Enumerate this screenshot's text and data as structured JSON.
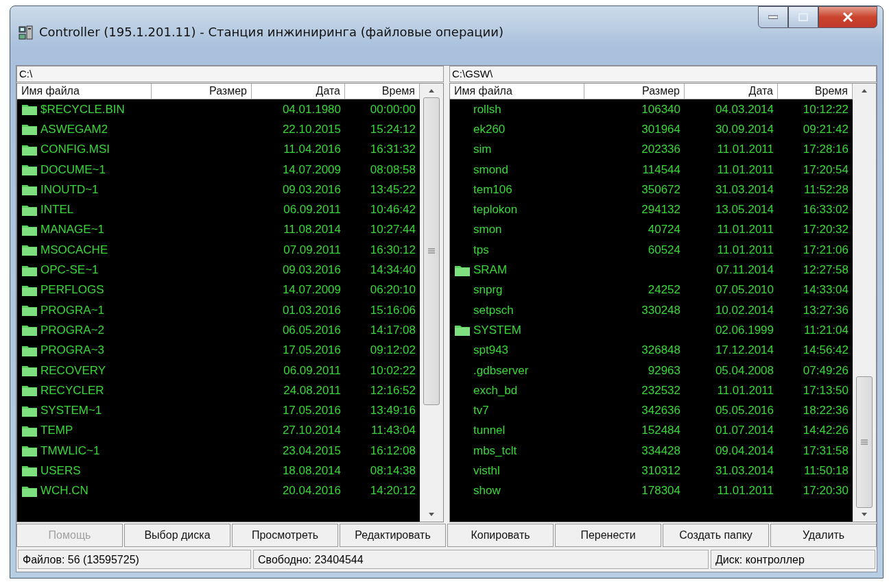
{
  "window": {
    "title": "Controller (195.1.201.11) - Станция инжиниринга (файловые операции)"
  },
  "panels": [
    {
      "path": "C:\\",
      "columns": [
        "Имя файла",
        "Размер",
        "Дата",
        "Время"
      ],
      "rows": [
        {
          "kind": "folder",
          "name": "$RECYCLE.BIN",
          "date": "04.01.1980",
          "time": "00:00:00"
        },
        {
          "kind": "folder",
          "name": "ASWEGAM2",
          "date": "22.10.2015",
          "time": "15:24:12"
        },
        {
          "kind": "folder",
          "name": "CONFIG.MSI",
          "date": "11.04.2016",
          "time": "16:31:32"
        },
        {
          "kind": "folder",
          "name": "DOCUME~1",
          "date": "14.07.2009",
          "time": "08:08:58"
        },
        {
          "kind": "folder",
          "name": "INOUTD~1",
          "date": "09.03.2016",
          "time": "13:45:22"
        },
        {
          "kind": "folder",
          "name": "INTEL",
          "date": "06.09.2011",
          "time": "10:46:42"
        },
        {
          "kind": "folder",
          "name": "MANAGE~1",
          "date": "11.08.2014",
          "time": "10:27:44"
        },
        {
          "kind": "folder",
          "name": "MSOCACHE",
          "date": "07.09.2011",
          "time": "16:30:12"
        },
        {
          "kind": "folder",
          "name": "OPC-SE~1",
          "date": "09.03.2016",
          "time": "14:34:40"
        },
        {
          "kind": "folder",
          "name": "PERFLOGS",
          "date": "14.07.2009",
          "time": "06:20:10"
        },
        {
          "kind": "folder",
          "name": "PROGRA~1",
          "date": "01.03.2016",
          "time": "15:16:06"
        },
        {
          "kind": "folder",
          "name": "PROGRA~2",
          "date": "06.05.2016",
          "time": "14:17:08"
        },
        {
          "kind": "folder",
          "name": "PROGRA~3",
          "date": "17.05.2016",
          "time": "09:12:02"
        },
        {
          "kind": "folder",
          "name": "RECOVERY",
          "date": "06.09.2011",
          "time": "10:02:22"
        },
        {
          "kind": "folder",
          "name": "RECYCLER",
          "date": "24.08.2011",
          "time": "12:16:52"
        },
        {
          "kind": "folder",
          "name": "SYSTEM~1",
          "date": "17.05.2016",
          "time": "13:49:16"
        },
        {
          "kind": "folder",
          "name": "TEMP",
          "date": "27.10.2014",
          "time": "11:43:04"
        },
        {
          "kind": "folder",
          "name": "TMWLIC~1",
          "date": "23.04.2015",
          "time": "16:12:08"
        },
        {
          "kind": "folder",
          "name": "USERS",
          "date": "18.08.2014",
          "time": "08:14:38"
        },
        {
          "kind": "folder",
          "name": "WCH.CN",
          "date": "20.04.2016",
          "time": "14:20:12"
        }
      ]
    },
    {
      "path": "C:\\GSW\\",
      "columns": [
        "Имя файла",
        "Размер",
        "Дата",
        "Время"
      ],
      "rows": [
        {
          "kind": "file",
          "name": "rollsh",
          "size": "106340",
          "date": "04.03.2014",
          "time": "10:12:22"
        },
        {
          "kind": "file",
          "name": "ek260",
          "size": "301964",
          "date": "30.09.2014",
          "time": "09:21:42"
        },
        {
          "kind": "file",
          "name": "sim",
          "size": "202336",
          "date": "11.01.2011",
          "time": "17:28:16"
        },
        {
          "kind": "file",
          "name": "smond",
          "size": "114544",
          "date": "11.01.2011",
          "time": "17:20:54"
        },
        {
          "kind": "file",
          "name": "tem106",
          "size": "350672",
          "date": "31.03.2014",
          "time": "11:52:28"
        },
        {
          "kind": "file",
          "name": "teplokon",
          "size": "294132",
          "date": "13.05.2014",
          "time": "16:33:02"
        },
        {
          "kind": "file",
          "name": "smon",
          "size": "40724",
          "date": "11.01.2011",
          "time": "17:20:32"
        },
        {
          "kind": "file",
          "name": "tps",
          "size": "60524",
          "date": "11.01.2011",
          "time": "17:21:06"
        },
        {
          "kind": "folder",
          "name": "SRAM",
          "date": "07.11.2014",
          "time": "12:27:58"
        },
        {
          "kind": "file",
          "name": "snprg",
          "size": "24252",
          "date": "07.05.2010",
          "time": "14:33:04"
        },
        {
          "kind": "file",
          "name": "setpsch",
          "size": "330248",
          "date": "10.02.2014",
          "time": "13:27:36"
        },
        {
          "kind": "folder",
          "name": "SYSTEM",
          "date": "02.06.1999",
          "time": "11:21:04"
        },
        {
          "kind": "file",
          "name": "spt943",
          "size": "326848",
          "date": "17.12.2014",
          "time": "14:56:42"
        },
        {
          "kind": "file",
          "name": ".gdbserver",
          "size": "92963",
          "date": "05.04.2008",
          "time": "07:49:26"
        },
        {
          "kind": "file",
          "name": "exch_bd",
          "size": "232532",
          "date": "11.01.2011",
          "time": "17:13:50"
        },
        {
          "kind": "file",
          "name": "tv7",
          "size": "342636",
          "date": "05.05.2016",
          "time": "18:22:36"
        },
        {
          "kind": "file",
          "name": "tunnel",
          "size": "152484",
          "date": "01.07.2014",
          "time": "14:42:26"
        },
        {
          "kind": "file",
          "name": "mbs_tclt",
          "size": "334428",
          "date": "09.04.2014",
          "time": "17:31:58"
        },
        {
          "kind": "file",
          "name": "visthl",
          "size": "310312",
          "date": "31.03.2014",
          "time": "11:50:18"
        },
        {
          "kind": "file",
          "name": "show",
          "size": "178304",
          "date": "11.01.2011",
          "time": "17:20:30"
        }
      ]
    }
  ],
  "buttons": [
    {
      "label": "Помощь",
      "disabled": true
    },
    {
      "label": "Выбор диска",
      "disabled": false
    },
    {
      "label": "Просмотреть",
      "disabled": false
    },
    {
      "label": "Редактировать",
      "disabled": false
    },
    {
      "label": "Копировать",
      "disabled": false
    },
    {
      "label": "Перенести",
      "disabled": false
    },
    {
      "label": "Создать папку",
      "disabled": false
    },
    {
      "label": "Удалить",
      "disabled": false
    }
  ],
  "status_bar": [
    "Файлов: 56 (13595725)",
    "Свободно: 23404544",
    "Диск: контроллер"
  ]
}
